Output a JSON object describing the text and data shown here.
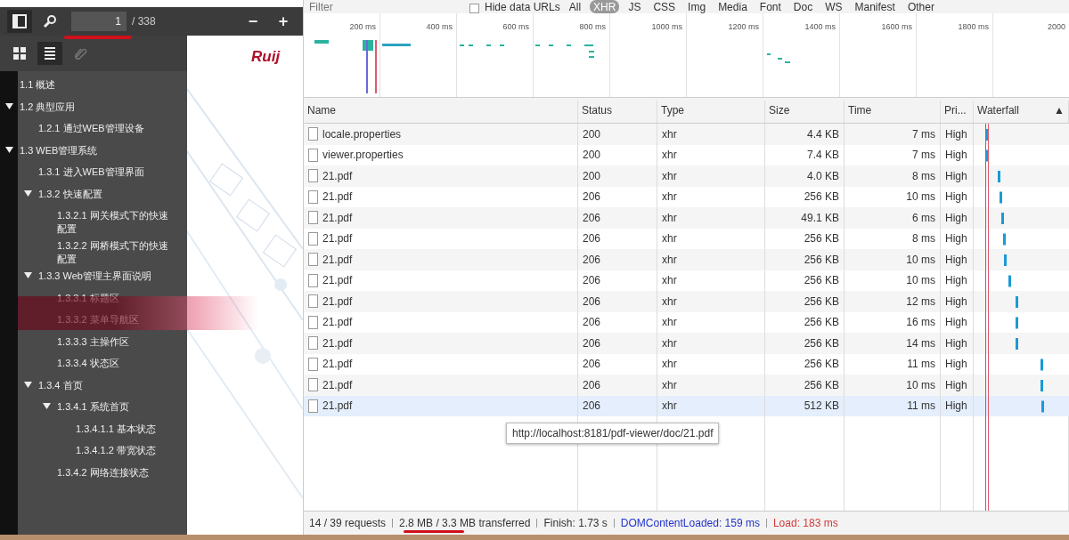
{
  "viewer": {
    "toolbar": {
      "page_value": "1",
      "page_total": "/ 338",
      "zoom_out": "−",
      "zoom_in": "+"
    },
    "sidebar_tabs": [
      {
        "kind": "thumbnails",
        "selected": false
      },
      {
        "kind": "outline",
        "selected": true
      },
      {
        "kind": "attachments",
        "selected": false
      }
    ],
    "outline": [
      {
        "label": "1.1 概述"
      },
      {
        "label": "1.2 典型应用",
        "expanded": true,
        "children": [
          {
            "label": "1.2.1 通过WEB管理设备"
          }
        ]
      },
      {
        "label": "1.3 WEB管理系统",
        "expanded": true,
        "children": [
          {
            "label": "1.3.1 进入WEB管理界面"
          },
          {
            "label": "1.3.2 快速配置",
            "expanded": true,
            "children": [
              {
                "label": "1.3.2.1 网关模式下的快速配置"
              },
              {
                "label": "1.3.2.2 网桥模式下的快速配置"
              }
            ]
          },
          {
            "label": "1.3.3 Web管理主界面说明",
            "expanded": true,
            "children": [
              {
                "label": "1.3.3.1 标题区"
              },
              {
                "label": "1.3.3.2 菜单导航区"
              },
              {
                "label": "1.3.3.3 主操作区"
              },
              {
                "label": "1.3.3.4 状态区"
              }
            ]
          },
          {
            "label": "1.3.4 首页",
            "expanded": true,
            "children": [
              {
                "label": "1.3.4.1 系统首页",
                "expanded": true,
                "children": [
                  {
                    "label": "1.3.4.1.1 基本状态"
                  },
                  {
                    "label": "1.3.4.1.2 带宽状态"
                  }
                ]
              },
              {
                "label": "1.3.4.2 网络连接状态"
              }
            ]
          }
        ]
      }
    ],
    "page": {
      "logo": "Ruij"
    }
  },
  "network": {
    "filter": {
      "placeholder": "Filter"
    },
    "hide_data_urls": {
      "label": "Hide data URLs",
      "checked": false
    },
    "types": [
      {
        "label": "All",
        "selected": false
      },
      {
        "label": "XHR",
        "selected": true
      },
      {
        "label": "JS",
        "selected": false
      },
      {
        "label": "CSS",
        "selected": false
      },
      {
        "label": "Img",
        "selected": false
      },
      {
        "label": "Media",
        "selected": false
      },
      {
        "label": "Font",
        "selected": false
      },
      {
        "label": "Doc",
        "selected": false
      },
      {
        "label": "WS",
        "selected": false
      },
      {
        "label": "Manifest",
        "selected": false
      },
      {
        "label": "Other",
        "selected": false
      }
    ],
    "timeline_ticks": [
      "200 ms",
      "400 ms",
      "600 ms",
      "800 ms",
      "1000 ms",
      "1200 ms",
      "1400 ms",
      "1600 ms",
      "1800 ms",
      "2000"
    ],
    "columns": [
      "Name",
      "Status",
      "Type",
      "Size",
      "Time",
      "Pri...",
      "Waterfall"
    ],
    "sort_indicator": "▲",
    "rows": [
      {
        "name": "locale.properties",
        "status": "200",
        "type": "xhr",
        "size": "4.4 KB",
        "time": "7 ms",
        "priority": "High",
        "selected": false
      },
      {
        "name": "viewer.properties",
        "status": "200",
        "type": "xhr",
        "size": "7.4 KB",
        "time": "7 ms",
        "priority": "High",
        "selected": false
      },
      {
        "name": "21.pdf",
        "status": "200",
        "type": "xhr",
        "size": "4.0 KB",
        "time": "8 ms",
        "priority": "High",
        "selected": false
      },
      {
        "name": "21.pdf",
        "status": "206",
        "type": "xhr",
        "size": "256 KB",
        "time": "10 ms",
        "priority": "High",
        "selected": false
      },
      {
        "name": "21.pdf",
        "status": "206",
        "type": "xhr",
        "size": "49.1 KB",
        "time": "6 ms",
        "priority": "High",
        "selected": false
      },
      {
        "name": "21.pdf",
        "status": "206",
        "type": "xhr",
        "size": "256 KB",
        "time": "8 ms",
        "priority": "High",
        "selected": false
      },
      {
        "name": "21.pdf",
        "status": "206",
        "type": "xhr",
        "size": "256 KB",
        "time": "10 ms",
        "priority": "High",
        "selected": false
      },
      {
        "name": "21.pdf",
        "status": "206",
        "type": "xhr",
        "size": "256 KB",
        "time": "10 ms",
        "priority": "High",
        "selected": false
      },
      {
        "name": "21.pdf",
        "status": "206",
        "type": "xhr",
        "size": "256 KB",
        "time": "12 ms",
        "priority": "High",
        "selected": false
      },
      {
        "name": "21.pdf",
        "status": "206",
        "type": "xhr",
        "size": "256 KB",
        "time": "16 ms",
        "priority": "High",
        "selected": false
      },
      {
        "name": "21.pdf",
        "status": "206",
        "type": "xhr",
        "size": "256 KB",
        "time": "14 ms",
        "priority": "High",
        "selected": false
      },
      {
        "name": "21.pdf",
        "status": "206",
        "type": "xhr",
        "size": "256 KB",
        "time": "11 ms",
        "priority": "High",
        "selected": false
      },
      {
        "name": "21.pdf",
        "status": "206",
        "type": "xhr",
        "size": "256 KB",
        "time": "10 ms",
        "priority": "High",
        "selected": false
      },
      {
        "name": "21.pdf",
        "status": "206",
        "type": "xhr",
        "size": "512 KB",
        "time": "11 ms",
        "priority": "High",
        "selected": true
      }
    ],
    "tooltip": "http://localhost:8181/pdf-viewer/doc/21.pdf",
    "status": [
      {
        "text": "14 / 39 requests",
        "kind": "plain"
      },
      {
        "text": "2.8 MB / 3.3 MB transferred",
        "kind": "plain"
      },
      {
        "text": "Finish: 1.73 s",
        "kind": "plain"
      },
      {
        "text": "DOMContentLoaded: 159 ms",
        "kind": "dom"
      },
      {
        "text": "Load: 183 ms",
        "kind": "load"
      }
    ]
  }
}
